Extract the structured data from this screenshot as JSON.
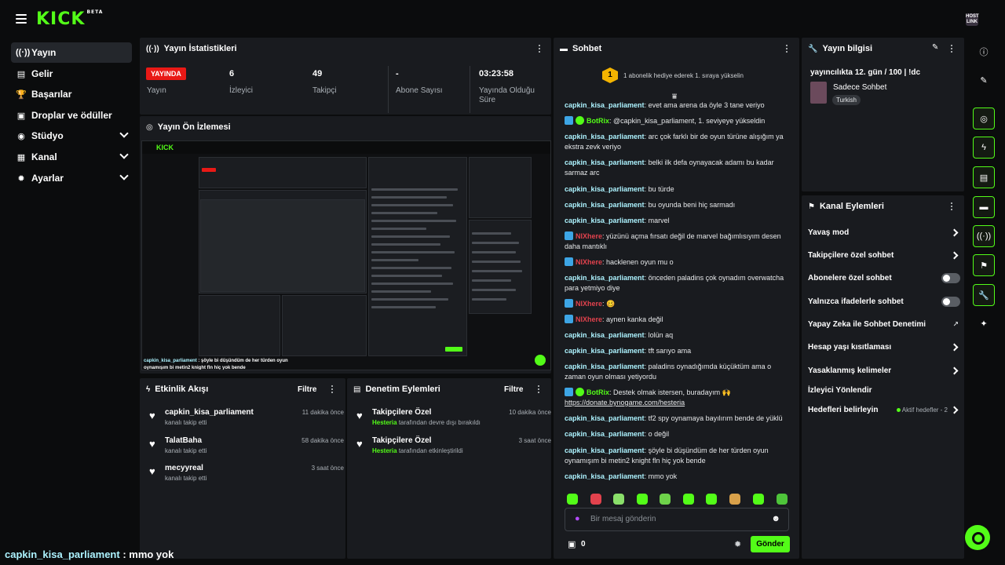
{
  "app": {
    "logo": "KICK",
    "logo_beta": "BETA",
    "avatar_text": "HOST LINK"
  },
  "sidebar": {
    "items": [
      {
        "label": "Yayın",
        "icon": "broadcast-icon"
      },
      {
        "label": "Gelir",
        "icon": "revenue-icon"
      },
      {
        "label": "Başarılar",
        "icon": "trophy-icon"
      },
      {
        "label": "Droplar ve ödüller",
        "icon": "gift-icon"
      },
      {
        "label": "Stüdyo",
        "icon": "studio-icon"
      },
      {
        "label": "Kanal",
        "icon": "channel-icon"
      },
      {
        "label": "Ayarlar",
        "icon": "gear-icon"
      }
    ]
  },
  "stats": {
    "title": "Yayın İstatistikleri",
    "live_badge": "YAYINDA",
    "live_label": "Yayın",
    "viewers_value": "6",
    "viewers_label": "İzleyici",
    "followers_value": "49",
    "followers_label": "Takipçi",
    "subs_value": "-",
    "subs_label": "Abone Sayısı",
    "uptime_value": "03:23:58",
    "uptime_label_1": "Yayında Olduğu",
    "uptime_label_2": "Süre"
  },
  "preview": {
    "title": "Yayın Ön İzlemesi",
    "caption_user": "capkin_kisa_parliament",
    "caption_text": ": şöyle bi düşündüm de her türden oyun oynamışım bi metin2 knight fln hiç yok bende"
  },
  "activity": {
    "title": "Etkinlik Akışı",
    "filter": "Filtre",
    "items": [
      {
        "name": "capkin_kisa_parliament",
        "sub": "kanalı takip etti",
        "time": "11 dakika önce"
      },
      {
        "name": "TalatBaha",
        "sub": "kanalı takip etti",
        "time": "58 dakika önce"
      },
      {
        "name": "mecyyreal",
        "sub": "kanalı takip etti",
        "time": "3 saat önce"
      }
    ]
  },
  "moderation": {
    "title": "Denetim Eylemleri",
    "filter": "Filtre",
    "items": [
      {
        "name": "Takipçilere Özel",
        "actor": "Hesteria",
        "sub": "tarafından devre dışı bırakıldı",
        "time": "10 dakika önce"
      },
      {
        "name": "Takipçilere Özel",
        "actor": "Hesteria",
        "sub": "tarafından etkinleştirildi",
        "time": "3 saat önce"
      }
    ]
  },
  "chat": {
    "title": "Sohbet",
    "gift_count": "1",
    "gift_text": "1 abonelik hediye ederek 1. sıraya yükselin",
    "messages": [
      {
        "user": "capkin_kisa_parliament",
        "color": "blue",
        "text": "evet ama arena da öyle 3 tane veriyo"
      },
      {
        "user": "BotRix",
        "color": "green",
        "text": "@capkin_kisa_parliament, 1. seviyeye yükseldin"
      },
      {
        "user": "capkin_kisa_parliament",
        "color": "blue",
        "text": "arc çok farklı bir de oyun türüne alışığım ya ekstra zevk veriyo"
      },
      {
        "user": "capkin_kisa_parliament",
        "color": "blue",
        "text": "belki ilk defa oynayacak adamı bu kadar sarmaz arc"
      },
      {
        "user": "capkin_kisa_parliament",
        "color": "blue",
        "text": "bu türde"
      },
      {
        "user": "capkin_kisa_parliament",
        "color": "blue",
        "text": "bu oyunda beni hiç sarmadı"
      },
      {
        "user": "capkin_kisa_parliament",
        "color": "blue",
        "text": "marvel"
      },
      {
        "user": "NIXhere",
        "color": "red",
        "text": "yüzünü açma fırsatı değil de marvel bağımlısıyım desen daha mantıklı"
      },
      {
        "user": "NIXhere",
        "color": "red",
        "text": "hacklenen oyun mu o"
      },
      {
        "user": "capkin_kisa_parliament",
        "color": "blue",
        "text": "önceden paladins çok oynadım overwatcha para yetmiyo diye"
      },
      {
        "user": "NIXhere",
        "color": "red",
        "text": "🥴"
      },
      {
        "user": "NIXhere",
        "color": "red",
        "text": "aynen kanka değil"
      },
      {
        "user": "capkin_kisa_parliament",
        "color": "blue",
        "text": "lolün aq"
      },
      {
        "user": "capkin_kisa_parliament",
        "color": "blue",
        "text": "tft sarıyo ama"
      },
      {
        "user": "capkin_kisa_parliament",
        "color": "blue",
        "text": "paladins oynadığımda küçüktüm ama o zaman oyun olması yetiyordu"
      },
      {
        "user": "BotRix",
        "color": "green",
        "text": "Destek olmak istersen, buradayım 🙌 ",
        "link": "https://donate.bynogame.com/hesteria"
      },
      {
        "user": "capkin_kisa_parliament",
        "color": "blue",
        "text": "tf2 spy oynamaya bayılırım bende de yüklü"
      },
      {
        "user": "capkin_kisa_parliament",
        "color": "blue",
        "text": "o değil"
      },
      {
        "user": "capkin_kisa_parliament",
        "color": "blue",
        "text": "şöyle bi düşündüm de her türden oyun oynamışım bi metin2 knight fln hiç yok bende"
      },
      {
        "user": "capkin_kisa_parliament",
        "color": "blue",
        "text": "mmo yok"
      }
    ],
    "input_placeholder": "Bir mesaj gönderin",
    "points": "0",
    "send_label": "Gönder"
  },
  "stream_info": {
    "title": "Yayın bilgisi",
    "stream_title": "yayıncılıkta 12. gün / 100 | !dc",
    "category": "Sadece Sohbet",
    "tag": "Turkish"
  },
  "channel_actions": {
    "title": "Kanal Eylemleri",
    "items": [
      {
        "label": "Yavaş mod",
        "control": "arrow"
      },
      {
        "label": "Takipçilere özel sohbet",
        "control": "arrow"
      },
      {
        "label": "Abonelere özel sohbet",
        "control": "toggle"
      },
      {
        "label": "Yalnızca ifadelerle sohbet",
        "control": "toggle"
      },
      {
        "label": "Yapay Zeka ile Sohbet Denetimi",
        "control": "external"
      },
      {
        "label": "Hesap yaşı kısıtlaması",
        "control": "arrow"
      },
      {
        "label": "Yasaklanmış kelimeler",
        "control": "arrow"
      },
      {
        "label": "İzleyici Yönlendir",
        "control": "none"
      },
      {
        "label": "Hedefleri belirleyin",
        "control": "arrow",
        "extra": "Aktif hedefler - 2"
      }
    ]
  },
  "bottom_caption": {
    "user": "capkin_kisa_parliament",
    "text": " : mmo yok"
  },
  "colors": {
    "accent": "#53fc18",
    "live": "#e91916",
    "user_blue": "#adf3ff",
    "user_red": "#e2424d"
  }
}
